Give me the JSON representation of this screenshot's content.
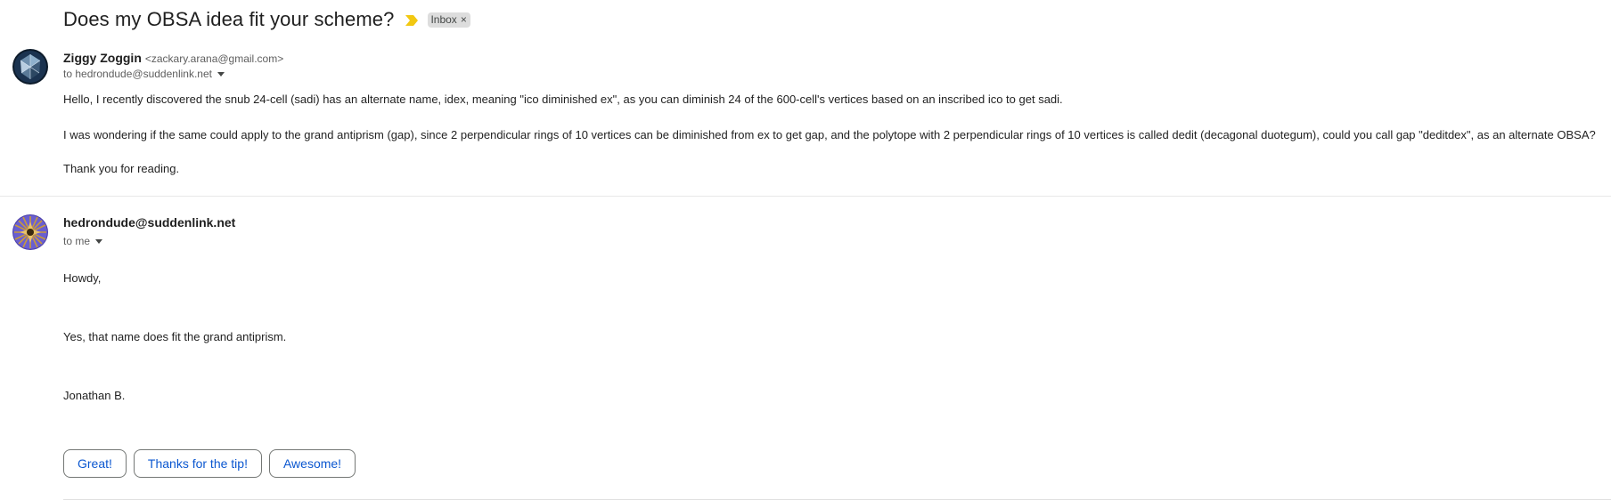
{
  "thread": {
    "subject": "Does my OBSA idea fit your scheme?",
    "label": "Inbox",
    "label_remove": "×",
    "importance_color": "#f2c811"
  },
  "messages": [
    {
      "sender_name": "Ziggy Zoggin",
      "sender_email": "<zackary.arana@gmail.com>",
      "recipient": "to hedrondude@suddenlink.net",
      "avatar": "polytope-avatar-blue",
      "body": [
        "Hello, I recently discovered the snub 24-cell (sadi) has an alternate name, idex, meaning \"ico diminished ex\", as you can diminish 24 of the 600-cell's vertices based on an inscribed ico to get sadi.",
        "I was wondering if the same could apply to the grand antiprism (gap), since 2 perpendicular rings of 10 vertices can be diminished from ex to get gap, and the polytope with 2 perpendicular rings of 10 vertices is called dedit (decagonal duotegum), could you call gap \"deditdex\", as an alternate OBSA?",
        "Thank you for reading."
      ]
    },
    {
      "sender_name": "hedrondude@suddenlink.net",
      "recipient": "to me",
      "avatar": "polytope-avatar-star",
      "body": [
        "Howdy,",
        "Yes, that name does fit the grand antiprism.",
        "Jonathan B."
      ]
    }
  ],
  "smart_replies": [
    "Great!",
    "Thanks for the tip!",
    "Awesome!"
  ],
  "colors": {
    "accent": "#0b57d0",
    "label_bg": "#dddddd"
  }
}
